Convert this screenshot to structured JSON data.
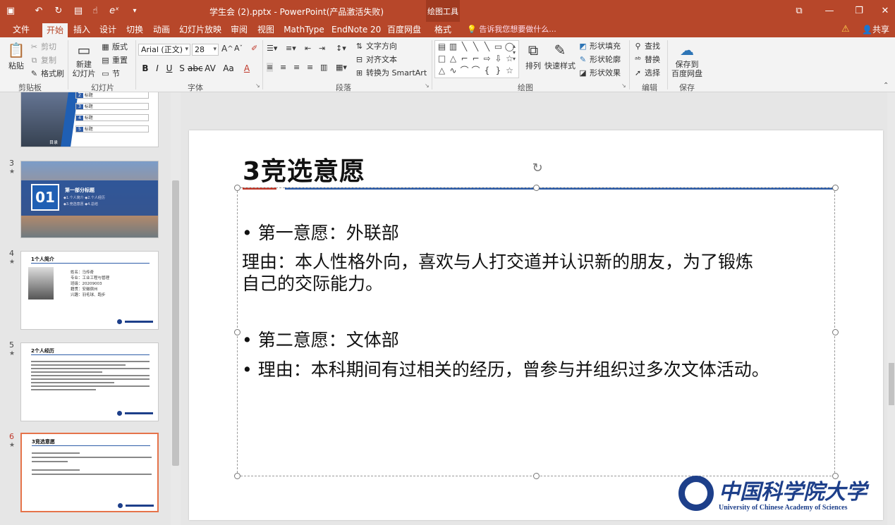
{
  "window": {
    "title": "学生会 (2).pptx - PowerPoint(产品激活失败)",
    "context_tab_label": "绘图工具"
  },
  "tabs": [
    "文件",
    "开始",
    "插入",
    "设计",
    "切换",
    "动画",
    "幻灯片放映",
    "审阅",
    "视图",
    "MathType",
    "EndNote 20",
    "百度网盘",
    "格式"
  ],
  "active_tab": "开始",
  "tell_me": "告诉我您想要做什么...",
  "share": "共享",
  "ribbon": {
    "clipboard": {
      "group": "剪贴板",
      "paste": "粘贴",
      "cut": "剪切",
      "copy": "复制",
      "format_painter": "格式刷"
    },
    "slides": {
      "group": "幻灯片",
      "new_slide": "新建\n幻灯片",
      "layout": "版式",
      "reset": "重置",
      "section": "节"
    },
    "font": {
      "group": "字体",
      "font_name": "Arial (正文)",
      "font_size": "28"
    },
    "paragraph": {
      "group": "段落",
      "text_direction": "文字方向",
      "align_text": "对齐文本",
      "smartart": "转换为 SmartArt"
    },
    "drawing": {
      "group": "绘图",
      "arrange": "排列",
      "quick_styles": "快速样式",
      "shape_fill": "形状填充",
      "shape_outline": "形状轮廓",
      "shape_effects": "形状效果"
    },
    "editing": {
      "group": "编辑",
      "find": "查找",
      "replace": "替换",
      "select": "选择"
    },
    "save": {
      "group": "保存",
      "save_to_baidu": "保存到\n百度网盘"
    }
  },
  "thumbnails": [
    {
      "number": "3",
      "title": "第一部分标题",
      "big_number": "01",
      "items": [
        "◆1.个人简介",
        "◆2.个人经历",
        "◆3.竞选意愿",
        "◆4.总结"
      ]
    },
    {
      "number": "4",
      "title": "1个人简介",
      "fields": [
        "姓名：马传奇",
        "专业：工业工程与管理",
        "班级：20209003",
        "籍贯：安徽宿州",
        "兴趣：羽毛球、跑步"
      ]
    },
    {
      "number": "5",
      "title": "2个人经历"
    },
    {
      "number": "6",
      "title": "3竞选意愿"
    }
  ],
  "toc_thumb": {
    "rows": [
      "2",
      "3",
      "4",
      "5"
    ],
    "row_label": "标题",
    "bottom_label": "目录"
  },
  "slide": {
    "title": "3竞选意愿",
    "lines": [
      "• 第一意愿：外联部",
      "理由：本人性格外向，喜欢与人打交道并认识新的朋友，为了锻炼",
      "自己的交际能力。",
      "• 第二意愿：文体部",
      "• 理由：本科期间有过相关的经历，曾参与并组织过多次文体活动。"
    ],
    "logo_cn": "中国科学院大学",
    "logo_en": "University of Chinese Academy of Sciences"
  },
  "colors": {
    "accent": "#b7472a",
    "title_blue": "#2e5da8",
    "title_red": "#c0392b",
    "logo_blue": "#1d3f8a"
  }
}
